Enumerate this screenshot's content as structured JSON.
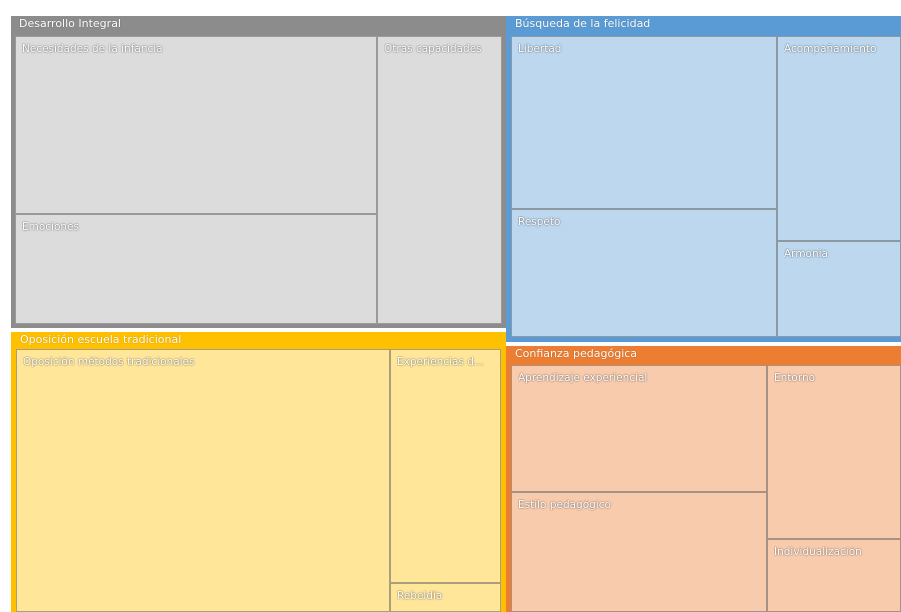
{
  "chart_data": {
    "type": "treemap",
    "groups": [
      {
        "name": "Desarrollo Integral",
        "color": "#8c8c8c",
        "fill": "#dcdcdc",
        "items": [
          {
            "name": "Necesidades de la infancia"
          },
          {
            "name": "Emociones"
          },
          {
            "name": "Otras capacidades"
          }
        ]
      },
      {
        "name": "Búsqueda de la felicidad",
        "color": "#5b9bd5",
        "fill": "#bdd7ee",
        "items": [
          {
            "name": "Libertad"
          },
          {
            "name": "Respeto"
          },
          {
            "name": "Acompañamiento"
          },
          {
            "name": "Armonía"
          }
        ]
      },
      {
        "name": "Oposición escuela tradicional",
        "color": "#ffc000",
        "fill": "#ffe699",
        "items": [
          {
            "name": "Oposición métodos tradicionales"
          },
          {
            "name": "Experiencias d..."
          },
          {
            "name": "Rebeldía"
          }
        ]
      },
      {
        "name": "Confianza pedagógica",
        "color": "#ed7d31",
        "fill": "#f8cbad",
        "items": [
          {
            "name": "Aprendizaje experiencial"
          },
          {
            "name": "Estilo pedagógico"
          },
          {
            "name": "Entorno"
          },
          {
            "name": "Individualización"
          }
        ]
      }
    ]
  }
}
